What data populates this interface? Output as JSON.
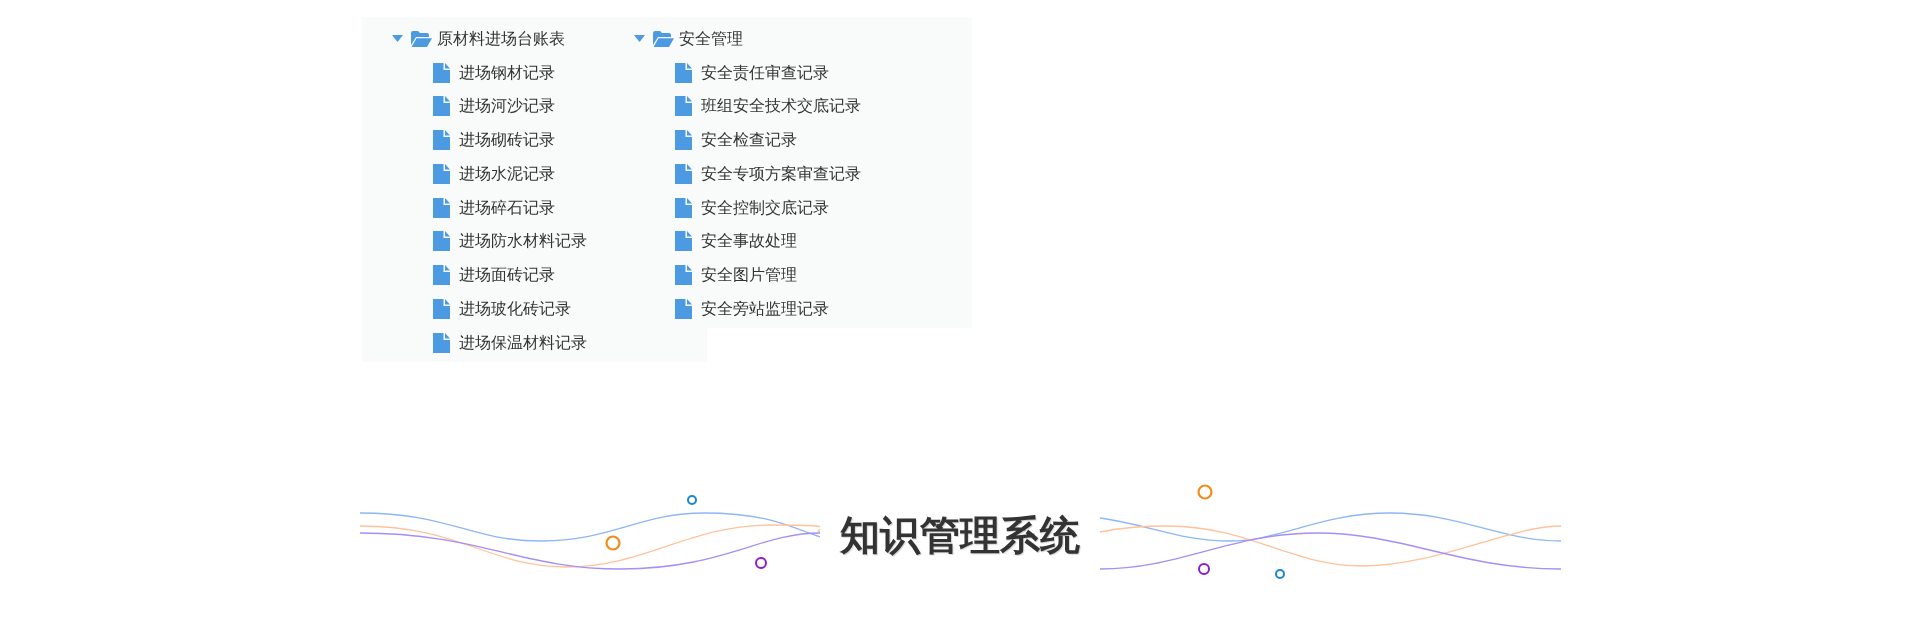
{
  "tree": [
    {
      "label": "原材料进场台账表",
      "expanded": true,
      "children": [
        {
          "label": "进场钢材记录"
        },
        {
          "label": "进场河沙记录"
        },
        {
          "label": "进场砌砖记录"
        },
        {
          "label": "进场水泥记录"
        },
        {
          "label": "进场碎石记录"
        },
        {
          "label": "进场防水材料记录"
        },
        {
          "label": "进场面砖记录"
        },
        {
          "label": "进场玻化砖记录"
        },
        {
          "label": "进场保温材料记录"
        }
      ]
    },
    {
      "label": "安全管理",
      "expanded": true,
      "children": [
        {
          "label": "安全责任审查记录"
        },
        {
          "label": "班组安全技术交底记录"
        },
        {
          "label": "安全检查记录"
        },
        {
          "label": "安全专项方案审查记录"
        },
        {
          "label": "安全控制交底记录"
        },
        {
          "label": "安全事故处理"
        },
        {
          "label": "安全图片管理"
        },
        {
          "label": "安全旁站监理记录"
        }
      ]
    }
  ],
  "title": "知识管理系统"
}
